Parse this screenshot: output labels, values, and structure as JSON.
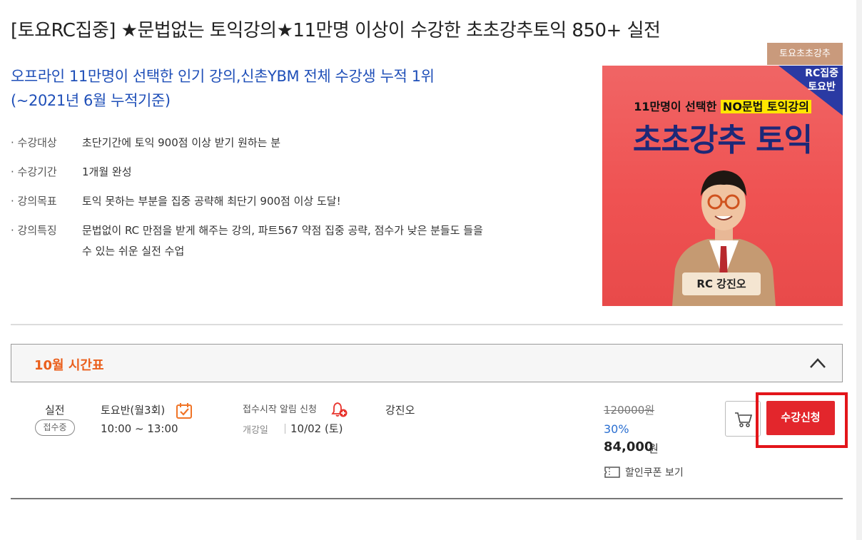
{
  "course": {
    "title": "[토요RC집중] ★문법없는 토익강의★11만명 이상이 수강한 초초강추토익 850+ 실전",
    "subtitle": "오프라인 11만명이 선택한 인기 강의,신촌YBM 전체 수강생 누적 1위(~2021년 6월 누적기준)",
    "info": [
      {
        "label": "· 수강대상",
        "value": "초단기간에 토익 900점 이상 받기 원하는 분"
      },
      {
        "label": "· 수강기간",
        "value": "1개월 완성"
      },
      {
        "label": "· 강의목표",
        "value": "토익 못하는 부분을 집중 공략해 최단기 900점 이상 도달!"
      },
      {
        "label": "· 강의특징",
        "value": "문법없이 RC 만점을 받게 해주는 강의, 파트567 약점 집중 공략, 점수가 낮은 분들도 들을 수 있는 쉬운 실전 수업"
      }
    ]
  },
  "thumbnail": {
    "tag": "토요초초강추",
    "corner_line1": "RC집중",
    "corner_line2": "토요반",
    "headline_prefix": "11만명이 선택한 ",
    "headline_highlight": "NO문법 토익강의",
    "brand": "초초강추 토익",
    "instructor_tag": "RC 강진오"
  },
  "timetable": {
    "month_title": "10월 시간표",
    "row": {
      "type": "실전",
      "status": "접수중",
      "schedule_name": "토요반(월3회)",
      "schedule_time": "10:00 ~ 13:00",
      "notify_label": "접수시작 알림 신청",
      "open_label": "개강일",
      "open_date": "10/02 (토)",
      "teacher": "강진오",
      "original_price": "120000원",
      "discount": "30%",
      "final_price": "84,000",
      "final_unit": "원",
      "coupon_label": "할인쿠폰 보기",
      "apply_label": "수강신청"
    }
  },
  "colors": {
    "subtitle_blue": "#1f4fb8",
    "month_orange": "#ea5f1c",
    "apply_red": "#e3262c",
    "discount_blue": "#2a6fd1",
    "tag_brown": "#c99a7c"
  },
  "icons": [
    "chevron-up-icon",
    "calendar-check-icon",
    "bell-plus-icon",
    "cart-icon",
    "coupon-icon"
  ]
}
